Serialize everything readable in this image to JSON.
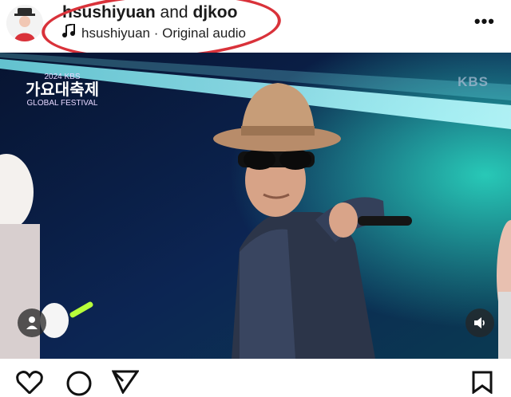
{
  "post": {
    "author_primary": "hsushiyuan",
    "joiner": "and",
    "author_secondary": "djkoo",
    "audio_label": "hsushiyuan · Original audio"
  },
  "video": {
    "watermark": "KBS",
    "event_logo": {
      "line1": "2024 KBS",
      "line2": "가요대축제",
      "line3": "GLOBAL FESTIVAL"
    }
  },
  "icons": {
    "more": "more-options-icon",
    "music": "music-note-icon",
    "user": "user-tag-icon",
    "sound": "speaker-icon",
    "like": "heart-icon",
    "comment": "comment-icon",
    "share": "send-icon",
    "save": "bookmark-icon"
  },
  "colors": {
    "annotation": "#d9323a",
    "stage": "#081738",
    "beam": "#6ff0ff"
  }
}
